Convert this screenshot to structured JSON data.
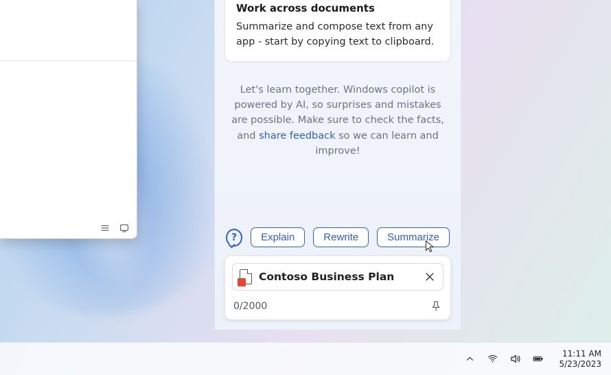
{
  "copilot": {
    "tip": {
      "title": "Work across documents",
      "body": "Summarize and compose text from any app - start by copying text to clipboard."
    },
    "disclaimer_pre": "Let's learn together. Windows copilot is powered by AI, so surprises and mistakes are possible. Make sure to check the facts, and ",
    "disclaimer_link": "share feedback",
    "disclaimer_post": " so we can learn and improve!",
    "actions": {
      "explain": "Explain",
      "rewrite": "Rewrite",
      "summarize": "Summarize"
    },
    "attachment": {
      "name": "Contoso Business Plan"
    },
    "counter": "0/2000",
    "help_glyph": "?"
  },
  "taskbar": {
    "time": "11:11 AM",
    "date": "5/23/2023"
  }
}
